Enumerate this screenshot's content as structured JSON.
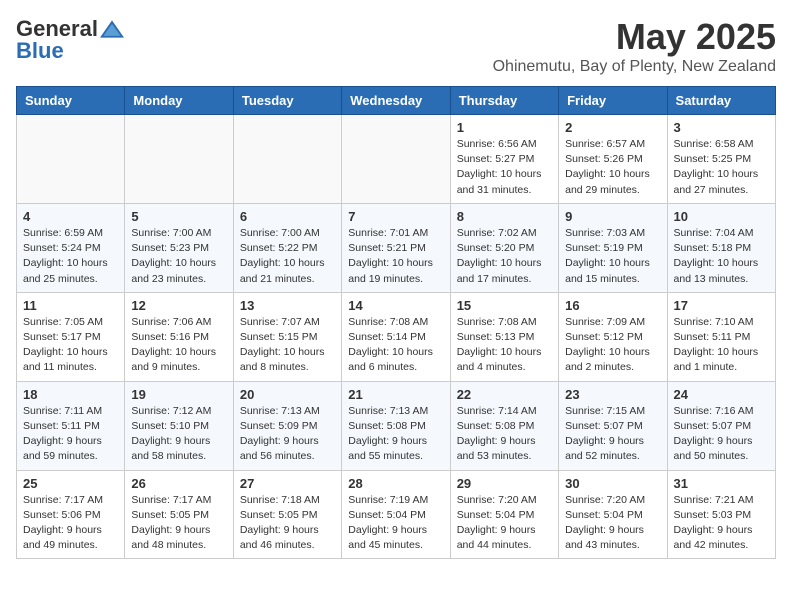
{
  "header": {
    "logo_general": "General",
    "logo_blue": "Blue",
    "month": "May 2025",
    "location": "Ohinemutu, Bay of Plenty, New Zealand"
  },
  "weekdays": [
    "Sunday",
    "Monday",
    "Tuesday",
    "Wednesday",
    "Thursday",
    "Friday",
    "Saturday"
  ],
  "weeks": [
    [
      {
        "day": "",
        "info": ""
      },
      {
        "day": "",
        "info": ""
      },
      {
        "day": "",
        "info": ""
      },
      {
        "day": "",
        "info": ""
      },
      {
        "day": "1",
        "info": "Sunrise: 6:56 AM\nSunset: 5:27 PM\nDaylight: 10 hours\nand 31 minutes."
      },
      {
        "day": "2",
        "info": "Sunrise: 6:57 AM\nSunset: 5:26 PM\nDaylight: 10 hours\nand 29 minutes."
      },
      {
        "day": "3",
        "info": "Sunrise: 6:58 AM\nSunset: 5:25 PM\nDaylight: 10 hours\nand 27 minutes."
      }
    ],
    [
      {
        "day": "4",
        "info": "Sunrise: 6:59 AM\nSunset: 5:24 PM\nDaylight: 10 hours\nand 25 minutes."
      },
      {
        "day": "5",
        "info": "Sunrise: 7:00 AM\nSunset: 5:23 PM\nDaylight: 10 hours\nand 23 minutes."
      },
      {
        "day": "6",
        "info": "Sunrise: 7:00 AM\nSunset: 5:22 PM\nDaylight: 10 hours\nand 21 minutes."
      },
      {
        "day": "7",
        "info": "Sunrise: 7:01 AM\nSunset: 5:21 PM\nDaylight: 10 hours\nand 19 minutes."
      },
      {
        "day": "8",
        "info": "Sunrise: 7:02 AM\nSunset: 5:20 PM\nDaylight: 10 hours\nand 17 minutes."
      },
      {
        "day": "9",
        "info": "Sunrise: 7:03 AM\nSunset: 5:19 PM\nDaylight: 10 hours\nand 15 minutes."
      },
      {
        "day": "10",
        "info": "Sunrise: 7:04 AM\nSunset: 5:18 PM\nDaylight: 10 hours\nand 13 minutes."
      }
    ],
    [
      {
        "day": "11",
        "info": "Sunrise: 7:05 AM\nSunset: 5:17 PM\nDaylight: 10 hours\nand 11 minutes."
      },
      {
        "day": "12",
        "info": "Sunrise: 7:06 AM\nSunset: 5:16 PM\nDaylight: 10 hours\nand 9 minutes."
      },
      {
        "day": "13",
        "info": "Sunrise: 7:07 AM\nSunset: 5:15 PM\nDaylight: 10 hours\nand 8 minutes."
      },
      {
        "day": "14",
        "info": "Sunrise: 7:08 AM\nSunset: 5:14 PM\nDaylight: 10 hours\nand 6 minutes."
      },
      {
        "day": "15",
        "info": "Sunrise: 7:08 AM\nSunset: 5:13 PM\nDaylight: 10 hours\nand 4 minutes."
      },
      {
        "day": "16",
        "info": "Sunrise: 7:09 AM\nSunset: 5:12 PM\nDaylight: 10 hours\nand 2 minutes."
      },
      {
        "day": "17",
        "info": "Sunrise: 7:10 AM\nSunset: 5:11 PM\nDaylight: 10 hours\nand 1 minute."
      }
    ],
    [
      {
        "day": "18",
        "info": "Sunrise: 7:11 AM\nSunset: 5:11 PM\nDaylight: 9 hours\nand 59 minutes."
      },
      {
        "day": "19",
        "info": "Sunrise: 7:12 AM\nSunset: 5:10 PM\nDaylight: 9 hours\nand 58 minutes."
      },
      {
        "day": "20",
        "info": "Sunrise: 7:13 AM\nSunset: 5:09 PM\nDaylight: 9 hours\nand 56 minutes."
      },
      {
        "day": "21",
        "info": "Sunrise: 7:13 AM\nSunset: 5:08 PM\nDaylight: 9 hours\nand 55 minutes."
      },
      {
        "day": "22",
        "info": "Sunrise: 7:14 AM\nSunset: 5:08 PM\nDaylight: 9 hours\nand 53 minutes."
      },
      {
        "day": "23",
        "info": "Sunrise: 7:15 AM\nSunset: 5:07 PM\nDaylight: 9 hours\nand 52 minutes."
      },
      {
        "day": "24",
        "info": "Sunrise: 7:16 AM\nSunset: 5:07 PM\nDaylight: 9 hours\nand 50 minutes."
      }
    ],
    [
      {
        "day": "25",
        "info": "Sunrise: 7:17 AM\nSunset: 5:06 PM\nDaylight: 9 hours\nand 49 minutes."
      },
      {
        "day": "26",
        "info": "Sunrise: 7:17 AM\nSunset: 5:05 PM\nDaylight: 9 hours\nand 48 minutes."
      },
      {
        "day": "27",
        "info": "Sunrise: 7:18 AM\nSunset: 5:05 PM\nDaylight: 9 hours\nand 46 minutes."
      },
      {
        "day": "28",
        "info": "Sunrise: 7:19 AM\nSunset: 5:04 PM\nDaylight: 9 hours\nand 45 minutes."
      },
      {
        "day": "29",
        "info": "Sunrise: 7:20 AM\nSunset: 5:04 PM\nDaylight: 9 hours\nand 44 minutes."
      },
      {
        "day": "30",
        "info": "Sunrise: 7:20 AM\nSunset: 5:04 PM\nDaylight: 9 hours\nand 43 minutes."
      },
      {
        "day": "31",
        "info": "Sunrise: 7:21 AM\nSunset: 5:03 PM\nDaylight: 9 hours\nand 42 minutes."
      }
    ]
  ]
}
